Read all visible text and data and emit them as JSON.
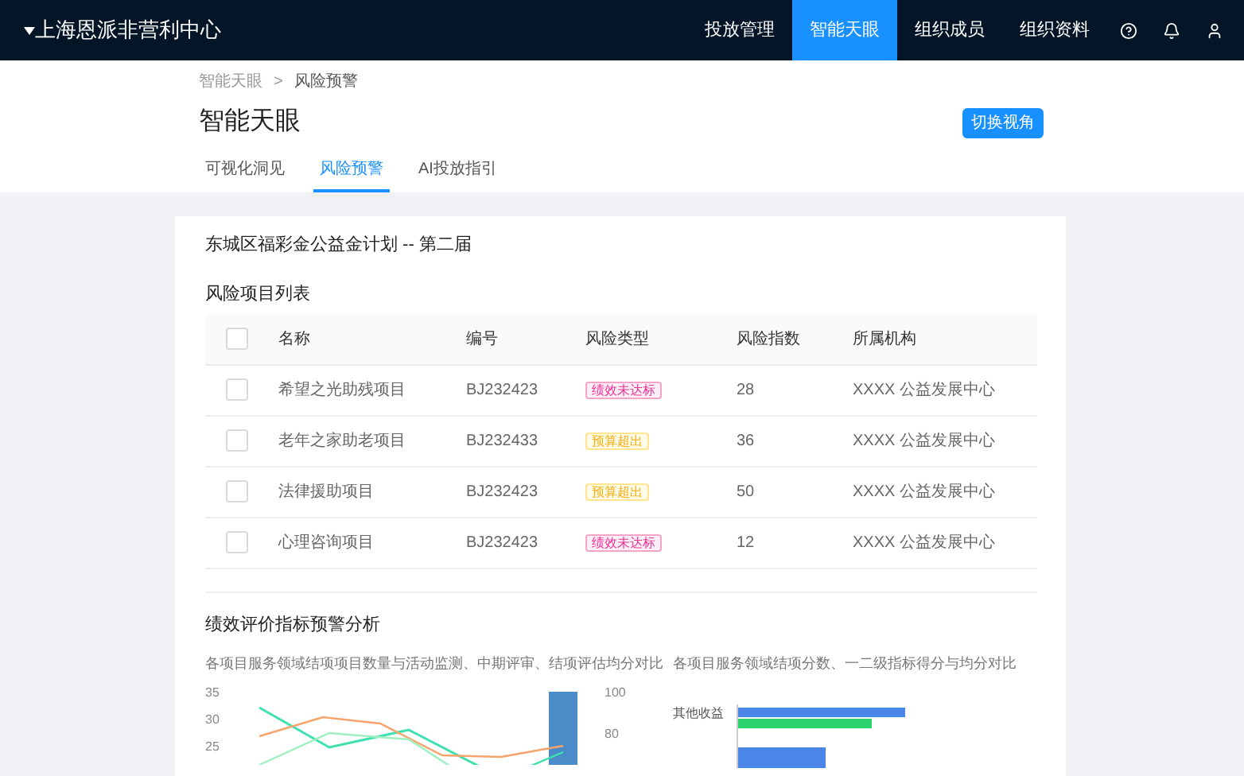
{
  "top_bar": {
    "org_name": "上海恩派非营利中心",
    "nav": [
      {
        "label": "投放管理",
        "selected": false
      },
      {
        "label": "智能天眼",
        "selected": true
      },
      {
        "label": "组织成员",
        "selected": false
      },
      {
        "label": "组织资料",
        "selected": false
      }
    ]
  },
  "breadcrumb": [
    "智能天眼",
    "风险预警"
  ],
  "breadcrumb_separator": ">",
  "page_title": "智能天眼",
  "switch_button": "切换视角",
  "tabs": [
    {
      "label": "可视化洞见",
      "selected": false
    },
    {
      "label": "风险预警",
      "selected": true
    },
    {
      "label": "AI投放指引",
      "selected": false
    }
  ],
  "card_title": "东城区福彩金公益金计划 -- 第二届",
  "risk_table": {
    "title": "风险项目列表",
    "header_checked": false,
    "columns": [
      "名称",
      "编号",
      "风险类型",
      "风险指数",
      "所属机构"
    ],
    "rows": [
      {
        "checked": false,
        "name": "希望之光助残项目",
        "code": "BJ232423",
        "risk_type": {
          "label": "绩效未达标",
          "kind": "performance"
        },
        "risk_index": "28",
        "org": "XXXX 公益发展中心"
      },
      {
        "checked": false,
        "name": "老年之家助老项目",
        "code": "BJ232433",
        "risk_type": {
          "label": "预算超出",
          "kind": "budget"
        },
        "risk_index": "36",
        "org": "XXXX 公益发展中心"
      },
      {
        "checked": false,
        "name": "法律援助项目",
        "code": "BJ232423",
        "risk_type": {
          "label": "预算超出",
          "kind": "budget"
        },
        "risk_index": "50",
        "org": "XXXX 公益发展中心"
      },
      {
        "checked": false,
        "name": "心理咨询项目",
        "code": "BJ232423",
        "risk_type": {
          "label": "绩效未达标",
          "kind": "performance"
        },
        "risk_index": "12",
        "org": "XXXX 公益发展中心"
      }
    ]
  },
  "analysis": {
    "title": "绩效评价指标预警分析",
    "left_chart": {
      "subtitle": "各项目服务领域结项项目数量与活动监测、中期评审、结项评估均分对比",
      "left_ticks": [
        "35",
        "30",
        "25"
      ],
      "right_ticks": [
        "100",
        "80"
      ]
    },
    "right_chart": {
      "subtitle": "各项目服务领域结项分数、一二级指标得分与均分对比",
      "categories": [
        "其他收益"
      ]
    }
  }
}
